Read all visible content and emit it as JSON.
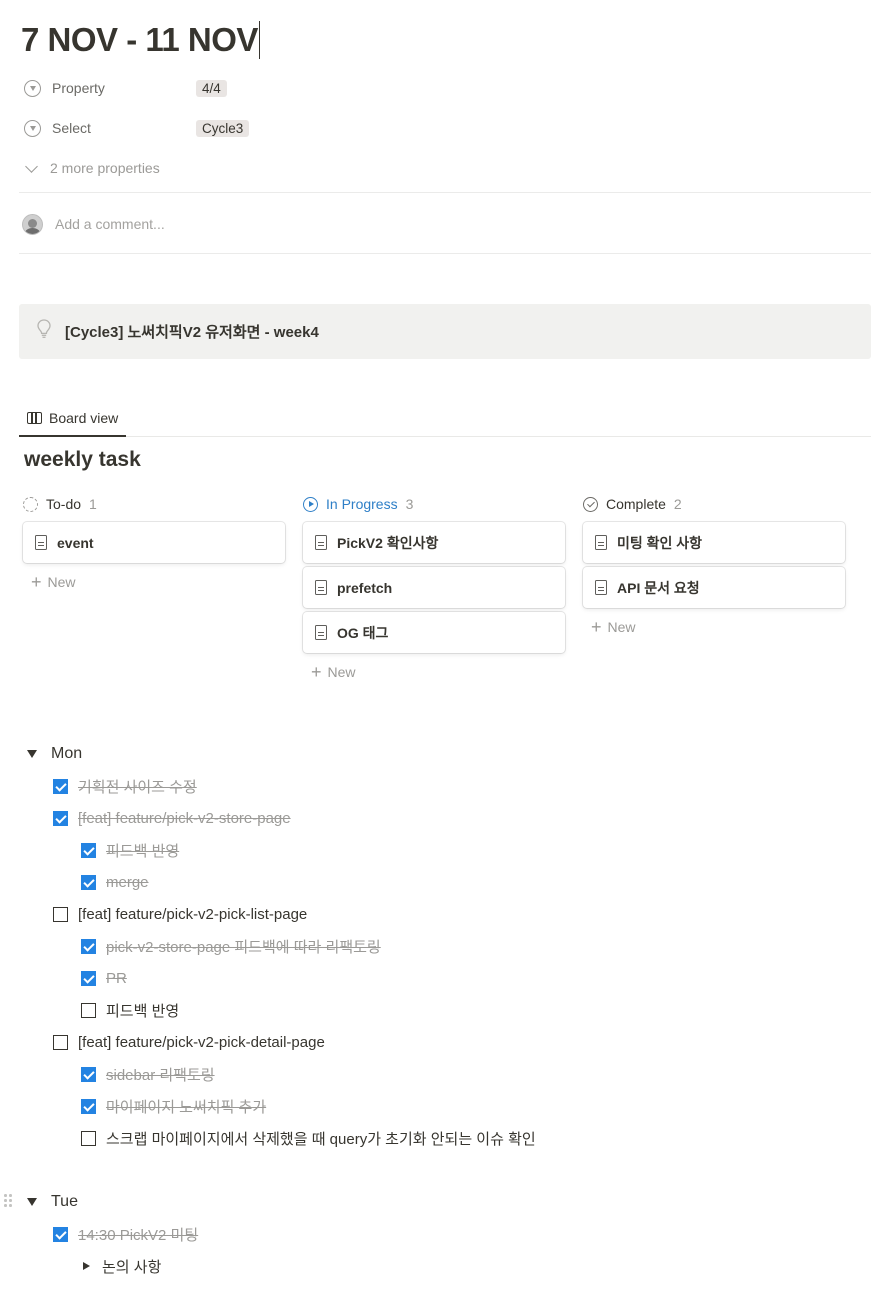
{
  "page": {
    "title": "7 NOV - 11 NOV",
    "properties": [
      {
        "name": "Property",
        "value": "4/4"
      },
      {
        "name": "Select",
        "value": "Cycle3"
      }
    ],
    "more_properties": "2 more properties",
    "comment_placeholder": "Add a comment..."
  },
  "callout": {
    "icon": "lightbulb-icon",
    "text": "[Cycle3] 노써치픽V2 유저화면 - week4"
  },
  "view_tab": {
    "label": "Board view",
    "icon": "board-icon"
  },
  "database": {
    "title": "weekly task",
    "new_label": "New",
    "columns": [
      {
        "name": "To-do",
        "count": "1",
        "color": "#37352f",
        "cards": [
          "event"
        ]
      },
      {
        "name": "In Progress",
        "count": "3",
        "color": "#2e7fc7",
        "cards": [
          "PickV2 확인사항",
          "prefetch",
          "OG 태그"
        ]
      },
      {
        "name": "Complete",
        "count": "2",
        "color": "#37352f",
        "cards": [
          "미팅 확인 사항",
          "API 문서 요청"
        ]
      }
    ]
  },
  "mon": {
    "label": "Mon",
    "items": [
      {
        "text": "기획전 사이즈 수정",
        "checked": true
      },
      {
        "text": "[feat] feature/pick-v2-store-page",
        "checked": true
      },
      {
        "text": "피드백 반영",
        "checked": true
      },
      {
        "text": "merge",
        "checked": true
      },
      {
        "text": "[feat] feature/pick-v2-pick-list-page",
        "checked": false
      },
      {
        "text": "pick-v2-store-page 피드백에 따라 리팩토링",
        "checked": true
      },
      {
        "text": "PR",
        "checked": true
      },
      {
        "text": "피드백 반영",
        "checked": false
      },
      {
        "text": "[feat] feature/pick-v2-pick-detail-page",
        "checked": false
      },
      {
        "text": "sidebar 리팩토링",
        "checked": true
      },
      {
        "text": "마이페이지 노써치픽 추가",
        "checked": true
      },
      {
        "text": "스크랩 마이페이지에서 삭제했을 때 query가 초기화 안되는 이슈 확인",
        "checked": false
      }
    ]
  },
  "tue": {
    "label": "Tue",
    "items": [
      {
        "text": "14:30 PickV2 미팅",
        "checked": true
      }
    ],
    "subtoggle": "논의 사항"
  }
}
